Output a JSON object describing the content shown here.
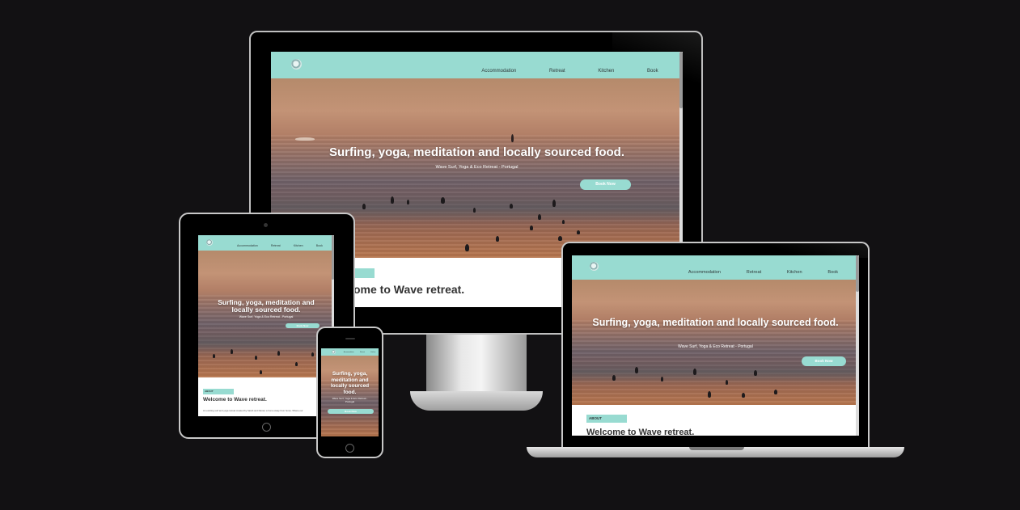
{
  "site": {
    "nav": {
      "accommodation": "Accommodation",
      "retreat": "Retreat",
      "kitchen": "Kitchen",
      "book": "Book"
    },
    "hero": {
      "title": "Surfing, yoga, meditation and locally sourced food.",
      "subtitle": "Wave Surf, Yoga & Eco Retreat - Portugal",
      "cta": "Book Now"
    },
    "about": {
      "tag": "ABOUT",
      "heading": "Welcome to Wave retreat.",
      "heading_partial": "ome to Wave retreat.",
      "body": "An exciting surf and yoga retreat created by Sarah and Daniel, a home away from home. Where our"
    }
  },
  "colors": {
    "accent": "#98dbd1",
    "background": "#121113",
    "device_frame": "#000000"
  }
}
